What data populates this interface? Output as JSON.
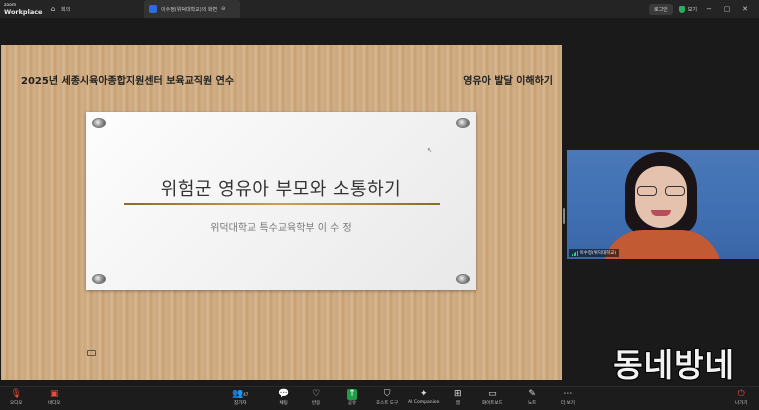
{
  "titlebar": {
    "brand_top": "zoom",
    "brand_bottom": "Workplace",
    "home_tab": "회의",
    "meeting_tab": "이수정(위덕대학교)의 화면",
    "login_button": "로그인",
    "view_button": "보기"
  },
  "slide": {
    "header_left": "2025년 세종시육아종합지원센터 보육교직원 연수",
    "header_right": "영유아 발달 이해하기",
    "title": "위험군 영유아 부모와 소통하기",
    "subtitle": "위덕대학교 특수교육학부    이 수 정"
  },
  "video": {
    "participant_name": "이수정(위덕대학교)"
  },
  "watermark": "동네방네",
  "toolbar": {
    "audio": "오디오",
    "video": "비디오",
    "participants": "참가자",
    "participants_count": "47",
    "chat": "채팅",
    "react": "반응",
    "share": "공유",
    "host_tools": "호스트 도구",
    "ai_companion": "AI Companion",
    "apps": "앱",
    "whiteboard": "화이트보드",
    "notes": "노트",
    "more": "더 보기",
    "leave": "나가기"
  },
  "icons": [
    "mic-muted-icon",
    "video-off-icon",
    "participants-icon",
    "chat-icon",
    "heart-icon",
    "share-icon",
    "shield-icon",
    "sparkle-icon",
    "apps-icon",
    "whiteboard-icon",
    "notes-icon",
    "more-icon",
    "leave-icon"
  ],
  "colors": {
    "share_green": "#1e9e4a",
    "muted_red": "#e74c3c",
    "security_green": "#27ae60",
    "title_line_gold": "#c9a24f"
  }
}
